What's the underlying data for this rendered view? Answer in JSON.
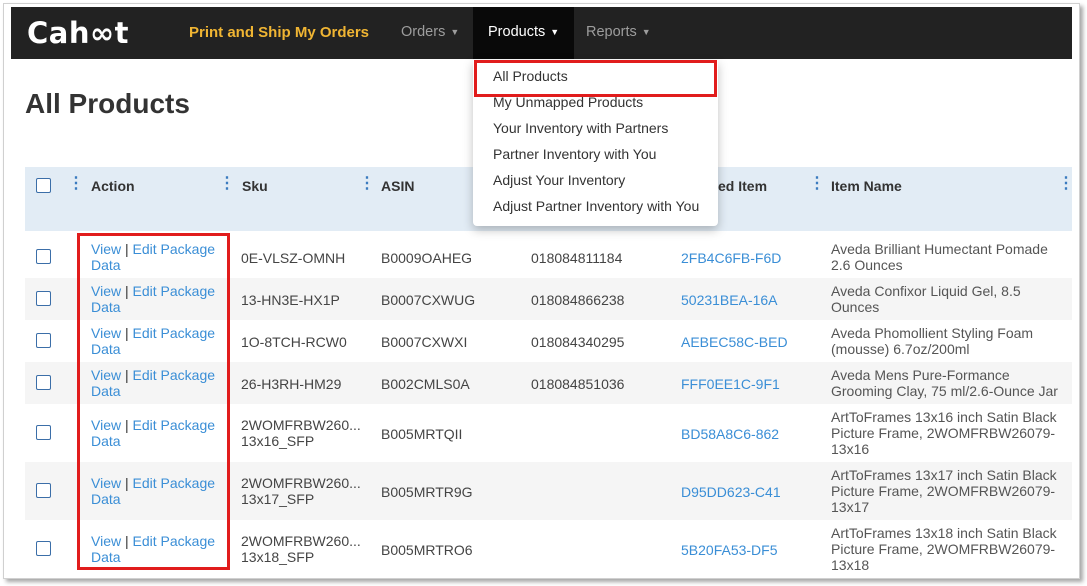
{
  "navbar": {
    "logo": "Cahoot",
    "brand_link": "Print and Ship My Orders",
    "menus": [
      {
        "label": "Orders"
      },
      {
        "label": "Products"
      },
      {
        "label": "Reports"
      }
    ]
  },
  "dropdown": {
    "items": [
      "All Products",
      "My Unmapped Products",
      "Your Inventory with Partners",
      "Partner Inventory with You",
      "Adjust Your Inventory",
      "Adjust Partner Inventory with You"
    ]
  },
  "page_title": "All Products",
  "table": {
    "headers": {
      "action": "Action",
      "sku": "Sku",
      "asin": "ASIN",
      "mapped_item": "ed Item",
      "item_name": "Item Name"
    },
    "action_view": "View",
    "action_sep": "|",
    "action_edit_1": "Edit Package",
    "action_edit_2": "Data",
    "rows": [
      {
        "sku1": "0E-VLSZ-OMNH",
        "sku2": "",
        "asin": "B0009OAHEG",
        "upc": "018084811184",
        "mapped": "2FB4C6FB-F6D",
        "name1": "Aveda Brilliant Humectant Pomade",
        "name2": "2.6 Ounces",
        "name3": ""
      },
      {
        "sku1": "13-HN3E-HX1P",
        "sku2": "",
        "asin": "B0007CXWUG",
        "upc": "018084866238",
        "mapped": "50231BEA-16A",
        "name1": "Aveda Confixor Liquid Gel, 8.5",
        "name2": "Ounces",
        "name3": ""
      },
      {
        "sku1": "1O-8TCH-RCW0",
        "sku2": "",
        "asin": "B0007CXWXI",
        "upc": "018084340295",
        "mapped": "AEBEC58C-BED",
        "name1": "Aveda Phomollient Styling Foam",
        "name2": "(mousse) 6.7oz/200ml",
        "name3": ""
      },
      {
        "sku1": "26-H3RH-HM29",
        "sku2": "",
        "asin": "B002CMLS0A",
        "upc": "018084851036",
        "mapped": "FFF0EE1C-9F1",
        "name1": "Aveda Mens Pure-Formance",
        "name2": "Grooming Clay, 75 ml/2.6-Ounce Jar",
        "name3": ""
      },
      {
        "sku1": "2WOMFRBW260...",
        "sku2": "13x16_SFP",
        "asin": "B005MRTQII",
        "upc": "",
        "mapped": "BD58A8C6-862",
        "name1": "ArtToFrames 13x16 inch Satin Black",
        "name2": "Picture Frame, 2WOMFRBW26079-",
        "name3": "13x16"
      },
      {
        "sku1": "2WOMFRBW260...",
        "sku2": "13x17_SFP",
        "asin": "B005MRTR9G",
        "upc": "",
        "mapped": "D95DD623-C41",
        "name1": "ArtToFrames 13x17 inch Satin Black",
        "name2": "Picture Frame, 2WOMFRBW26079-",
        "name3": "13x17"
      },
      {
        "sku1": "2WOMFRBW260...",
        "sku2": "13x18_SFP",
        "asin": "B005MRTRO6",
        "upc": "",
        "mapped": "5B20FA53-DF5",
        "name1": "ArtToFrames 13x18 inch Satin Black",
        "name2": "Picture Frame, 2WOMFRBW26079-",
        "name3": "13x18"
      }
    ]
  },
  "colors": {
    "highlight": "#e11c1c",
    "link": "#3a8ed6",
    "brand_link": "#f0b533",
    "navbar": "#222222"
  }
}
